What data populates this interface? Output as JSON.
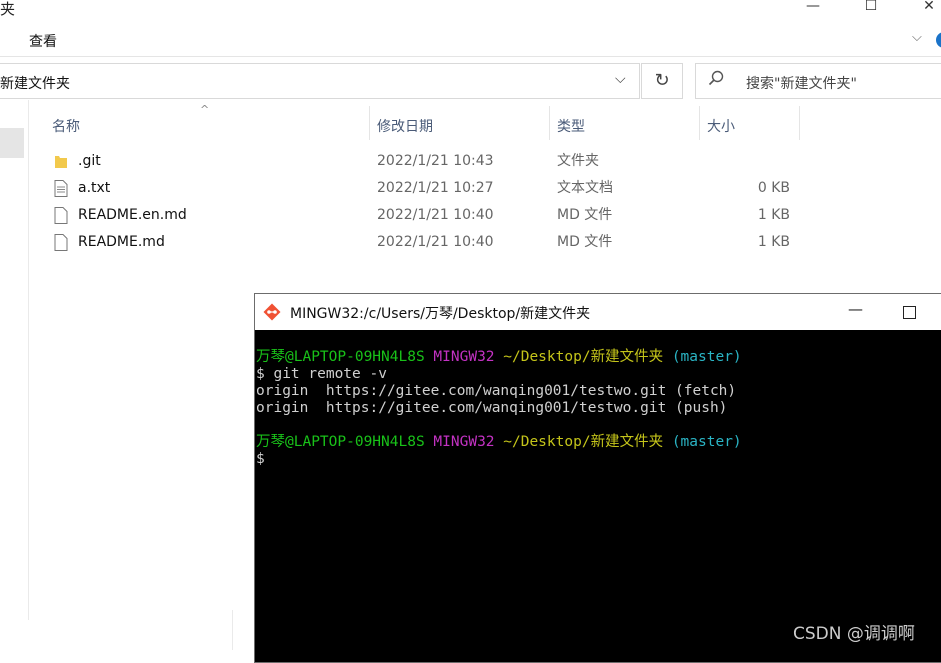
{
  "explorer": {
    "title_fragment": "夹",
    "window_controls": {
      "minimize": "—",
      "maximize": "☐",
      "close": "✕"
    },
    "ribbon": {
      "view_tab": "查看",
      "expand": "⌵"
    },
    "address": {
      "path": "新建文件夹",
      "dropdown": "⌵",
      "refresh": "↻"
    },
    "search": {
      "placeholder": "搜索\"新建文件夹\""
    },
    "columns": {
      "name": "名称",
      "date": "修改日期",
      "type": "类型",
      "size": "大小"
    },
    "files": [
      {
        "name": ".git",
        "date": "2022/1/21 10:43",
        "type": "文件夹",
        "size": "",
        "icon": "folder-icon"
      },
      {
        "name": "a.txt",
        "date": "2022/1/21 10:27",
        "type": "文本文档",
        "size": "0 KB",
        "icon": "text-file-icon"
      },
      {
        "name": "README.en.md",
        "date": "2022/1/21 10:40",
        "type": "MD 文件",
        "size": "1 KB",
        "icon": "file-icon"
      },
      {
        "name": "README.md",
        "date": "2022/1/21 10:40",
        "type": "MD 文件",
        "size": "1 KB",
        "icon": "file-icon"
      }
    ]
  },
  "terminal": {
    "title": "MINGW32:/c/Users/万琴/Desktop/新建文件夹",
    "minimize": "—",
    "prompt1": {
      "user": "万琴@LAPTOP-09HN4L8S",
      "env": "MINGW32",
      "path": "~/Desktop/新建文件夹",
      "branch": "(master)"
    },
    "command": "$ git remote -v",
    "output": [
      "origin  https://gitee.com/wanqing001/testwo.git (fetch)",
      "origin  https://gitee.com/wanqing001/testwo.git (push)"
    ],
    "prompt2": {
      "user": "万琴@LAPTOP-09HN4L8S",
      "env": "MINGW32",
      "path": "~/Desktop/新建文件夹",
      "branch": "(master)"
    },
    "cursor": "$"
  },
  "watermark": "CSDN @调调啊",
  "colors": {
    "terminal_bg": "#000000",
    "prompt_user": "#19c119",
    "prompt_env": "#c332c3",
    "prompt_path": "#c4c41a",
    "prompt_branch": "#2ab4c4"
  }
}
